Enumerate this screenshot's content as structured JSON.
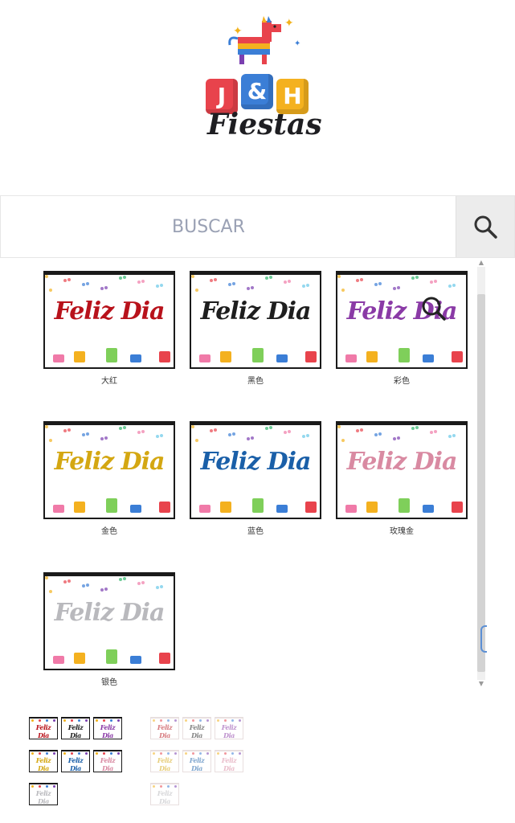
{
  "brand": {
    "blocks": [
      "J",
      "&",
      "H"
    ],
    "name": "Fiestas"
  },
  "search": {
    "placeholder": "BUSCAR"
  },
  "gallery": {
    "items": [
      {
        "text": "Feliz Dia",
        "color": "#b8121b",
        "caption": "大红"
      },
      {
        "text": "Feliz Dia",
        "color": "#1e1e1e",
        "caption": "黑色"
      },
      {
        "text": "Feliz Dia",
        "color": "#8a3aa6",
        "caption": "彩色"
      },
      {
        "text": "Feliz Dia",
        "color": "#d4a712",
        "caption": "金色"
      },
      {
        "text": "Feliz Dia",
        "color": "#1a5fa8",
        "caption": "蓝色"
      },
      {
        "text": "Feliz Dia",
        "color": "#d98aa2",
        "caption": "玫瑰金"
      },
      {
        "text": "Feliz Dia",
        "color": "#b9b9bd",
        "caption": "银色"
      }
    ]
  },
  "thumbnails": {
    "text": "Feliz Dia",
    "colors": [
      "#b8121b",
      "#1e1e1e",
      "#8a3aa6",
      "#d4a712",
      "#1a5fa8",
      "#d98aa2",
      "#b9b9bd"
    ]
  },
  "icons": {
    "search": "search-icon",
    "zoom": "zoom-icon"
  },
  "colors": {
    "block_j": "#e8434c",
    "block_amp": "#3b7ed6",
    "block_h": "#f4b11f",
    "placeholder": "#9aa1b4",
    "search_button_bg": "#ececec"
  }
}
